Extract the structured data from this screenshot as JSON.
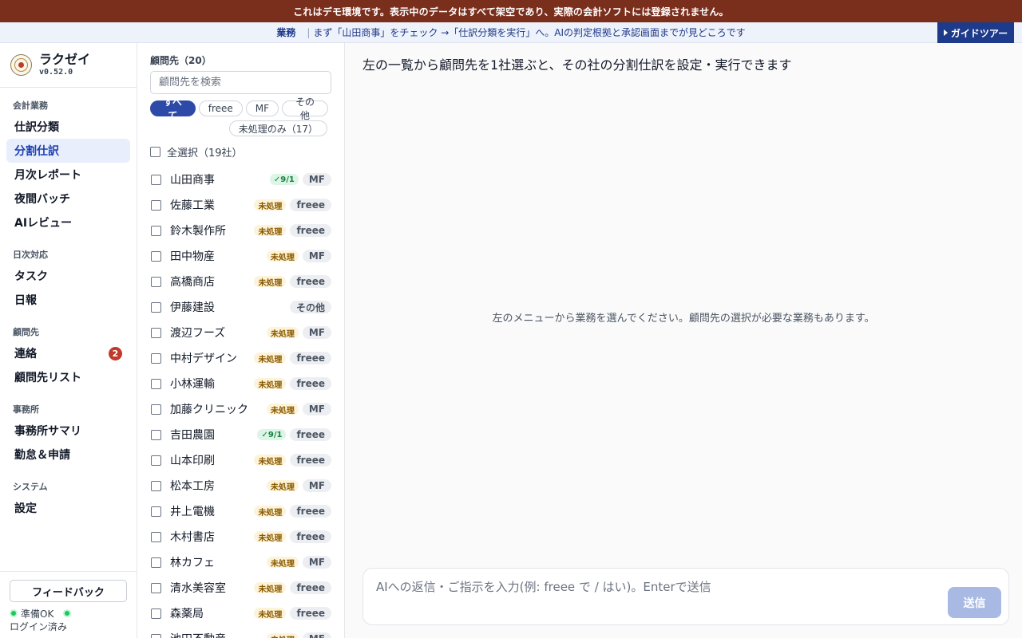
{
  "banner": {
    "text": "これはデモ環境です。表示中のデータはすべて架空であり、実際の会計ソフトには登録されません。"
  },
  "hint": {
    "tag": "業務",
    "separator": "|",
    "text": "まず「山田商事」をチェック →「仕訳分類を実行」へ。AIの判定根拠と承認画面までが見どころです",
    "guide_button": "ガイドツアー"
  },
  "brand": {
    "name": "ラクゼイ",
    "version": "v0.52.0"
  },
  "nav": {
    "sections": [
      {
        "label": "会計業務",
        "items": [
          {
            "label": "仕訳分類"
          },
          {
            "label": "分割仕訳",
            "active": true
          },
          {
            "label": "月次レポート"
          },
          {
            "label": "夜間バッチ"
          },
          {
            "label": "AIレビュー"
          }
        ]
      },
      {
        "label": "日次対応",
        "items": [
          {
            "label": "タスク"
          },
          {
            "label": "日報"
          }
        ]
      },
      {
        "label": "顧問先",
        "items": [
          {
            "label": "連絡",
            "badge": "2"
          },
          {
            "label": "顧問先リスト"
          }
        ]
      },
      {
        "label": "事務所",
        "items": [
          {
            "label": "事務所サマリ"
          },
          {
            "label": "勤怠＆申請"
          }
        ]
      },
      {
        "label": "システム",
        "items": [
          {
            "label": "設定"
          }
        ]
      }
    ]
  },
  "sidebar_footer": {
    "feedback_button": "フィードバック",
    "status_ready": "準備OK",
    "status_login": "ログイン済み"
  },
  "clients": {
    "title": "顧問先（20）",
    "search_placeholder": "顧問先を検索",
    "filters": [
      "すべて",
      "freee",
      "MF",
      "その他"
    ],
    "filter_unprocessed": "未処理のみ（17）",
    "select_all": "全選択（19社）",
    "items": [
      {
        "name": "山田商事",
        "status": "✓9/1",
        "status_type": "done",
        "software": "MF"
      },
      {
        "name": "佐藤工業",
        "status": "未処理",
        "status_type": "pending",
        "software": "freee"
      },
      {
        "name": "鈴木製作所",
        "status": "未処理",
        "status_type": "pending",
        "software": "freee"
      },
      {
        "name": "田中物産",
        "status": "未処理",
        "status_type": "pending",
        "software": "MF"
      },
      {
        "name": "高橋商店",
        "status": "未処理",
        "status_type": "pending",
        "software": "freee"
      },
      {
        "name": "伊藤建設",
        "status": "",
        "status_type": "none",
        "software": "その他"
      },
      {
        "name": "渡辺フーズ",
        "status": "未処理",
        "status_type": "pending",
        "software": "MF"
      },
      {
        "name": "中村デザイン",
        "status": "未処理",
        "status_type": "pending",
        "software": "freee"
      },
      {
        "name": "小林運輸",
        "status": "未処理",
        "status_type": "pending",
        "software": "freee"
      },
      {
        "name": "加藤クリニック",
        "status": "未処理",
        "status_type": "pending",
        "software": "MF"
      },
      {
        "name": "吉田農園",
        "status": "✓9/1",
        "status_type": "done",
        "software": "freee"
      },
      {
        "name": "山本印刷",
        "status": "未処理",
        "status_type": "pending",
        "software": "freee"
      },
      {
        "name": "松本工房",
        "status": "未処理",
        "status_type": "pending",
        "software": "MF"
      },
      {
        "name": "井上電機",
        "status": "未処理",
        "status_type": "pending",
        "software": "freee"
      },
      {
        "name": "木村書店",
        "status": "未処理",
        "status_type": "pending",
        "software": "freee"
      },
      {
        "name": "林カフェ",
        "status": "未処理",
        "status_type": "pending",
        "software": "MF"
      },
      {
        "name": "清水美容室",
        "status": "未処理",
        "status_type": "pending",
        "software": "freee"
      },
      {
        "name": "森薬局",
        "status": "未処理",
        "status_type": "pending",
        "software": "freee"
      },
      {
        "name": "池田不動産",
        "status": "未処理",
        "status_type": "pending",
        "software": "MF"
      }
    ]
  },
  "main": {
    "heading": "左の一覧から顧問先を1社選ぶと、その社の分割仕訳を設定・実行できます",
    "empty_message": "左のメニューから業務を選んでください。顧問先の選択が必要な業務もあります。",
    "composer_placeholder": "AIへの返信・ご指示を入力(例: freee で / はい)。Enterで送信",
    "send_button": "送信"
  },
  "colors": {
    "banner_bg": "#7a2e1c",
    "accent": "#2d4aa8",
    "guide_button_bg": "#1e3a8a",
    "badge_red": "#c0392b",
    "status_green": "#22c55e"
  }
}
